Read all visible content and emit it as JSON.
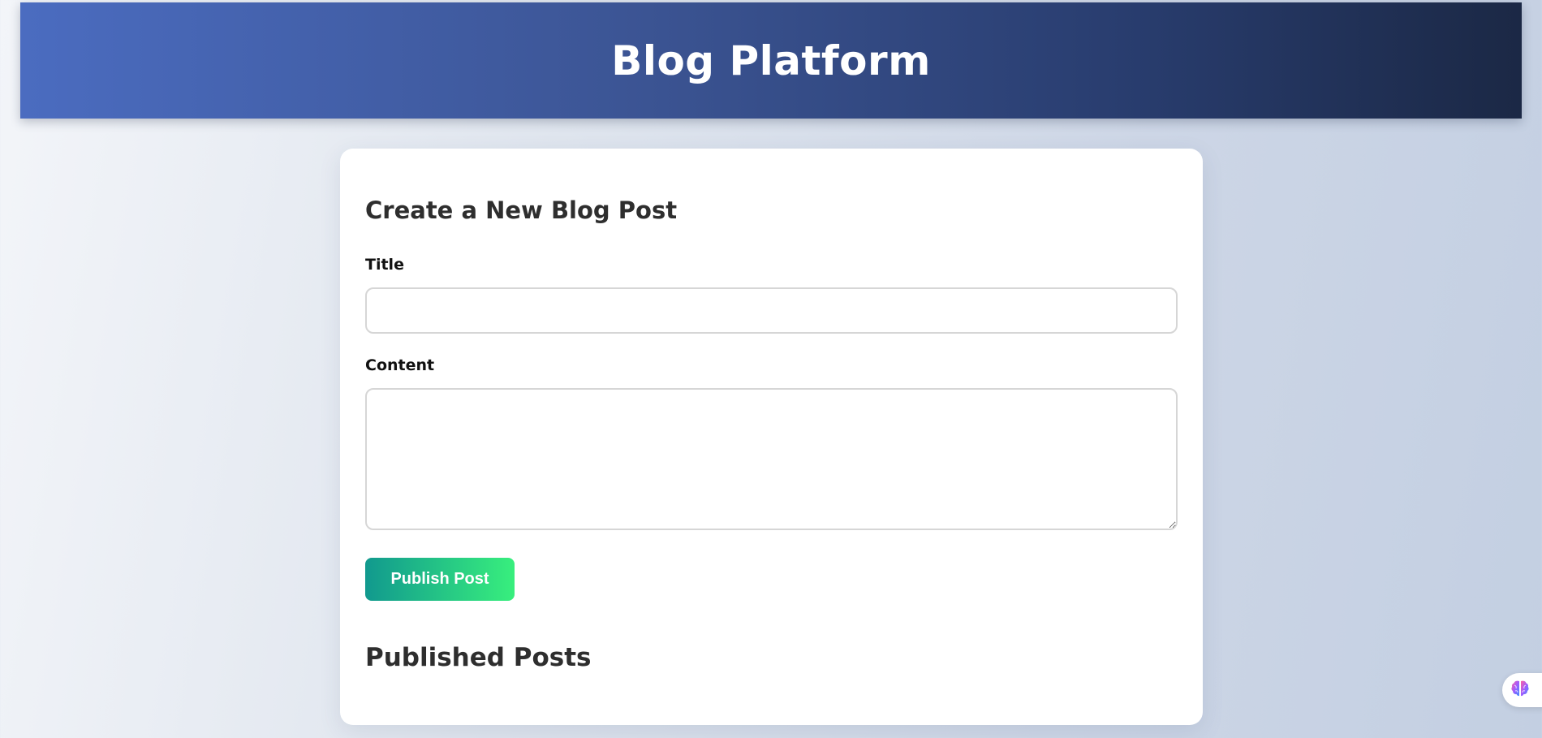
{
  "header": {
    "title": "Blog Platform"
  },
  "form": {
    "heading": "Create a New Blog Post",
    "title_label": "Title",
    "title_value": "",
    "content_label": "Content",
    "content_value": "",
    "submit_label": "Publish Post"
  },
  "posts": {
    "heading": "Published Posts",
    "items": []
  },
  "widget": {
    "icon": "brain-icon"
  },
  "colors": {
    "header_gradient_start": "#4b6cc0",
    "header_gradient_end": "#1b2845",
    "button_gradient_start": "#11998e",
    "button_gradient_end": "#38ef7d"
  }
}
